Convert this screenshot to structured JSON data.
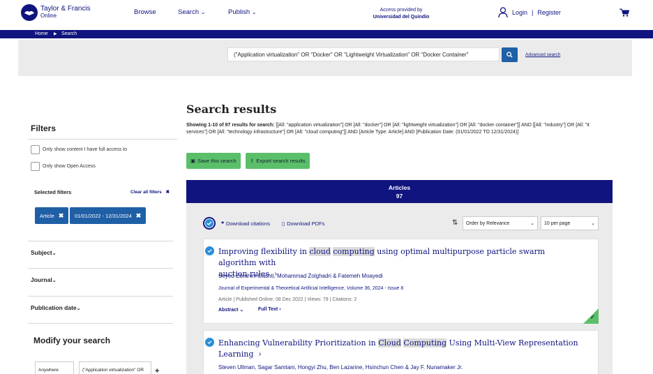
{
  "header": {
    "logo_line1": "Taylor & Francis",
    "logo_line2": "Online",
    "nav": [
      "Browse",
      "Search",
      "Publish"
    ],
    "access_line1": "Access provided by",
    "access_line2": "Universidad del Quindío",
    "login": "Login",
    "separator": "|",
    "register": "Register"
  },
  "breadcrumb": {
    "home": "Home",
    "arrow": "▶",
    "current": "Search"
  },
  "search": {
    "query": "(\"Application virtualization\" OR \"Docker\" OR \"Lightweight Virtualization\" OR \"Docker Container\"",
    "advanced": "Advanced search"
  },
  "filters": {
    "title": "Filters",
    "full_access": "Only show content I have full access to",
    "open_access": "Only show Open Access",
    "selected_title": "Selected filters",
    "clear_all": "Clear all filters",
    "chips": [
      "Article",
      "01/01/2022 - 12/31/2024"
    ],
    "facets": [
      "Subject",
      "Journal",
      "Publication date"
    ]
  },
  "modify": {
    "title": "Modify your search",
    "field": "Anywhere",
    "query": "(\"Application virtualization\" OR"
  },
  "results": {
    "title": "Search results",
    "showing_bold": "Showing 1-10 of 97 results for search:",
    "showing_rest": " [[All: \"application virtualization\"] OR [All: \"docker\"] OR [All: \"lightweight virtualization\"] OR [All: \"docker container\"]] AND [[All: \"industry\"] OR [All: \"it services\"] OR [All: \"technology infrastructure\"] OR [All: \"cloud computing\"]] AND [Article Type: Article] AND [Publication Date: (01/01/2022 TO 12/31/2024)]",
    "save": "Save this search",
    "export": "Export search results",
    "tab_label": "Articles",
    "tab_count": "97",
    "download_citations": "Download citations",
    "download_pdfs": "Download PDFs",
    "order": "Order by Relevance",
    "per_page": "10 per page"
  },
  "articles": [
    {
      "title_a": "Improving flexibility in ",
      "hl1": "cloud",
      "title_b": " ",
      "hl2": "computing",
      "title_c": " using optimal multipurpose particle swarm algorithm with",
      "title_line2": "auction rules",
      "authors": "Seyed Ebrahim Dashti, Mohammad Zolghadri & Fatemeh Moayedi",
      "journal": "Journal of Experimental & Theoretical Artificial Intelligence, Volume 36, 2024 - Issue 8",
      "meta": "Article | Published Online: 08 Dec 2022 | Views: 78 | Citations: 2",
      "abstract": "Abstract",
      "full_text": "Full Text"
    },
    {
      "title_a": "Enhancing Vulnerability Prioritization in ",
      "hl1": "Cloud",
      "title_b": " ",
      "hl2": "Computing",
      "title_c": " Using Multi-View Representation",
      "title_line2": "Learning",
      "authors": "Steven Ullman, Sagar Samtani, Hongyi Zhu, Ben Lazarine, Hsinchun Chen & Jay F. Nunamaker Jr."
    }
  ],
  "colors": {
    "navy": "#10147e",
    "blue": "#1f5fa6",
    "green": "#5bbf6a",
    "check": "#2b8fd8"
  }
}
